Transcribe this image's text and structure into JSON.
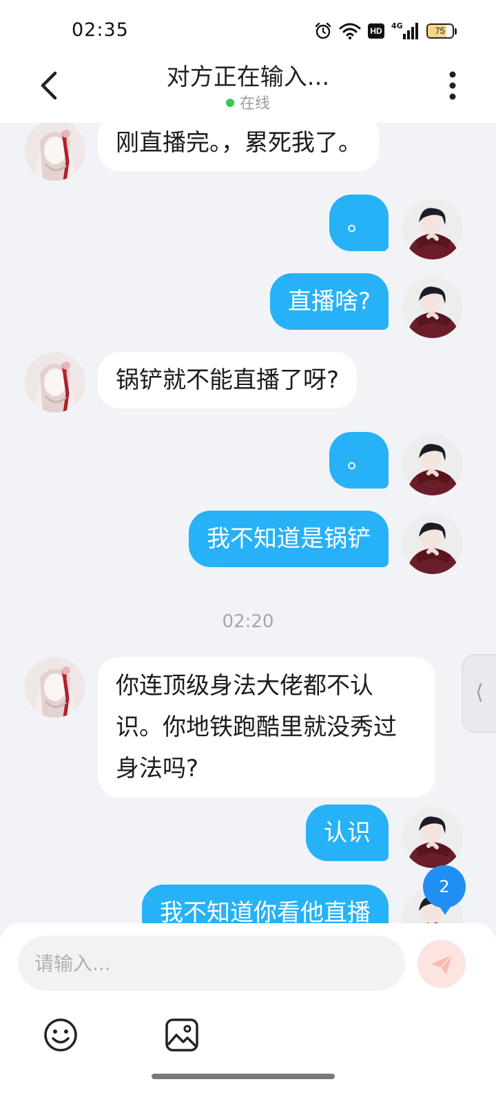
{
  "status_bar": {
    "time": "02:35",
    "network_label": "4G",
    "hd_label": "HD",
    "battery_level": "75",
    "battery_fraction": 0.75,
    "icons": [
      "alarm-icon",
      "wifi-icon",
      "hd-icon",
      "signal-icon",
      "battery-icon"
    ]
  },
  "header": {
    "title": "对方正在输入...",
    "status_text": "在线",
    "status_color": "#35c759",
    "back_icon": "chevron-left-icon",
    "more_icon": "more-vertical-icon"
  },
  "messages": [
    {
      "side": "left",
      "text": "刚直播完。，累死我了。"
    },
    {
      "side": "right",
      "text": "。"
    },
    {
      "side": "right",
      "text": "直播啥?"
    },
    {
      "side": "left",
      "text": "锅铲就不能直播了呀?"
    },
    {
      "side": "right",
      "text": "。"
    },
    {
      "side": "right",
      "text": "我不知道是锅铲"
    },
    {
      "side": "divider",
      "text": "02:20"
    },
    {
      "side": "left",
      "text": "你连顶级身法大佬都不认识。你地铁跑酷里就没秀过身法吗?"
    },
    {
      "side": "right",
      "text": "认识"
    },
    {
      "side": "right",
      "text": "我不知道你看他直播"
    }
  ],
  "side_handle": {
    "symbol": "⟨"
  },
  "unread_badge": {
    "count": "2"
  },
  "composer": {
    "placeholder": "请输入...",
    "send_icon": "send-icon",
    "toolbar_icons": [
      "emoji-icon",
      "image-icon"
    ]
  },
  "colors": {
    "accent": "#27b1f6",
    "background": "#f1f3f7",
    "badge": "#1f8ef5",
    "send_button": "#fde4e0"
  }
}
